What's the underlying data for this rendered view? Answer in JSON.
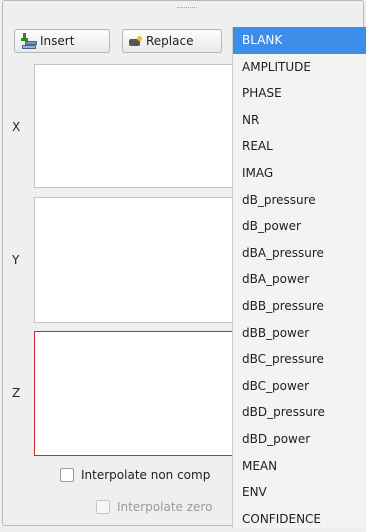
{
  "toolbar": {
    "insert_label": "Insert",
    "insert_icon": "insert-row-icon",
    "replace_label": "Replace",
    "replace_icon": "replace-icon"
  },
  "axes": {
    "x": "X",
    "y": "Y",
    "z": "Z"
  },
  "options": {
    "interpolate_non": "Interpolate non comp",
    "interpolate_zero": "Interpolate zero"
  },
  "dropdown": {
    "selected": "BLANK",
    "items": [
      "BLANK",
      "AMPLITUDE",
      "PHASE",
      "NR",
      "REAL",
      "IMAG",
      "dB_pressure",
      "dB_power",
      "dBA_pressure",
      "dBA_power",
      "dBB_pressure",
      "dBB_power",
      "dBC_pressure",
      "dBC_power",
      "dBD_pressure",
      "dBD_power",
      "MEAN",
      "ENV",
      "CONFIDENCE"
    ]
  },
  "colors": {
    "selection": "#3d8ee8",
    "error_border": "#c92a2a"
  }
}
